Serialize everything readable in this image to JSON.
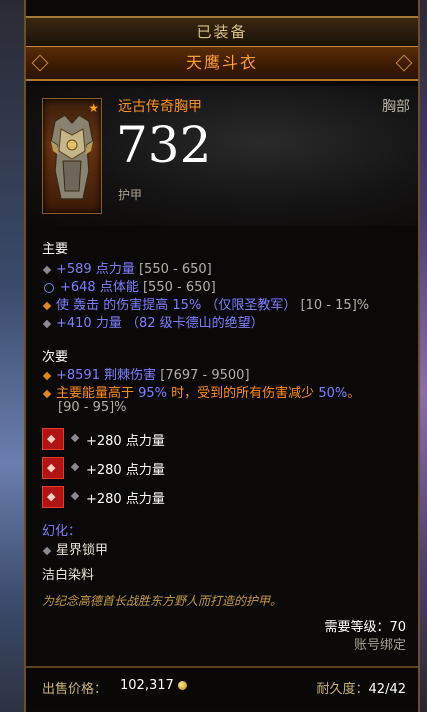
{
  "header": {
    "equipped_label": "已装备",
    "item_name": "天鹰斗衣"
  },
  "item": {
    "type": "远古传奇胸甲",
    "slot": "胸部",
    "armor_value": "732",
    "armor_label": "护甲",
    "icon": "chest-armor-icon"
  },
  "primary": {
    "title": "主要",
    "stats": [
      {
        "text": "+589 点力量",
        "range": "[550 - 650]"
      },
      {
        "text": "+648 点体能",
        "range": "[550 - 650]"
      },
      {
        "text": "使 轰击 的伤害提高 15% （仅限圣教军）",
        "range": "[10 - 15]%"
      },
      {
        "text": "+410 力量 （82 级卡德山的绝望）",
        "range": ""
      }
    ]
  },
  "secondary": {
    "title": "次要",
    "stats": [
      {
        "text": "+8591 荆棘伤害",
        "range": "[7697 - 9500]"
      },
      {
        "text_a": "主要能量高于 ",
        "text_b": "95%",
        "text_c": " 时，受到的所有伤害减少 ",
        "text_d": "50%",
        "text_e": "。",
        "range": "[90 - 95]%"
      }
    ]
  },
  "sockets": [
    {
      "text": "+280 点力量"
    },
    {
      "text": "+280 点力量"
    },
    {
      "text": "+280 点力量"
    }
  ],
  "transmog": {
    "title": "幻化：",
    "value": "星界锁甲"
  },
  "dye": "洁白染料",
  "flavor_text": "为纪念高德首长战胜东方野人而打造的护甲。",
  "requirements": {
    "level": "需要等级：70",
    "bound": "账号绑定"
  },
  "footer": {
    "price_label": "出售价格：",
    "price_value": "102,317",
    "durability_label": "耐久度：",
    "durability_value": "42/42"
  },
  "colors": {
    "legendary": "#ff8a1a",
    "magic": "#7d7dff",
    "socket": "#b01414"
  }
}
